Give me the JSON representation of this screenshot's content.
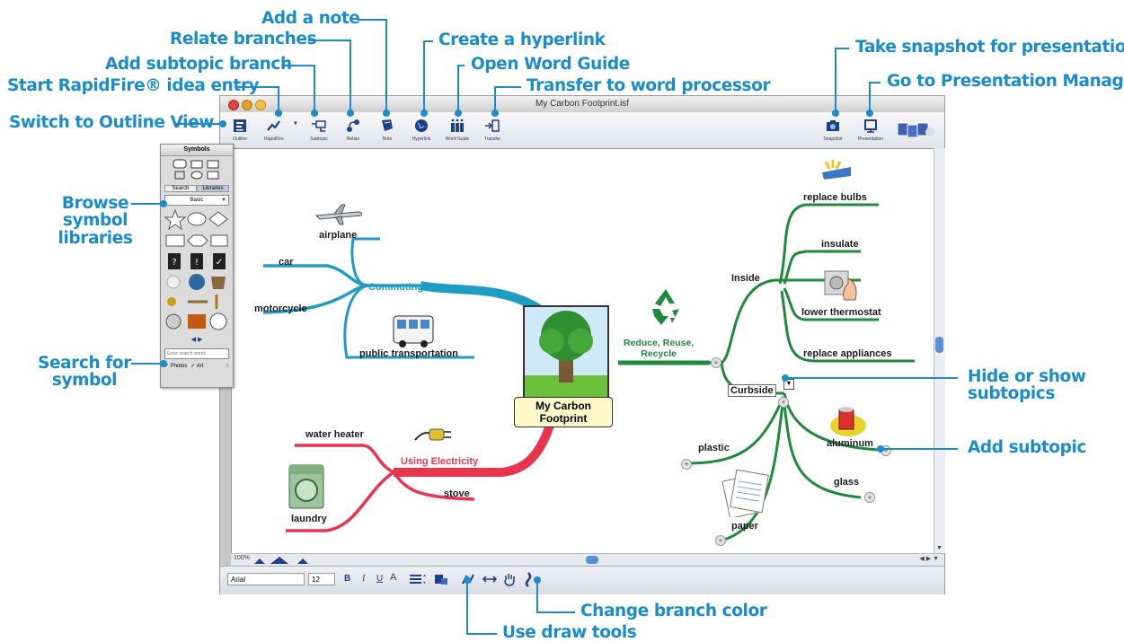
{
  "annotations": {
    "add_note": "Add a note",
    "relate_branches": "Relate branches",
    "create_hyperlink": "Create a hyperlink",
    "add_subtopic_branch": "Add subtopic branch",
    "open_word_guide": "Open Word Guide",
    "start_rapidfire": "Start RapidFire® idea entry",
    "transfer_word_processor": "Transfer to word processor",
    "switch_outline": "Switch to Outline View",
    "take_snapshot": "Take snapshot for presentation",
    "go_presentation": "Go to Presentation Manager",
    "browse_symbol": "Browse\nsymbol\nlibraries",
    "search_symbol": "Search for\nsymbol",
    "hide_show": "Hide or show\nsubtopics",
    "add_subtopic": "Add subtopic",
    "change_branch_color": "Change branch color",
    "use_draw_tools": "Use draw tools"
  },
  "window": {
    "title": "My Carbon Footprint.isf"
  },
  "toolbar": {
    "outline": "Outline",
    "rapidfire": "RapidFire",
    "subtopic": "Subtopic",
    "relate": "Relate",
    "note": "Note",
    "hyperlink": "Hyperlink",
    "word_guide": "Word Guide",
    "transfer": "Transfer",
    "snapshot": "Snapshot",
    "presentation": "Presentation"
  },
  "symbols_panel": {
    "title": "Symbols",
    "tab_search": "Search",
    "tab_libraries": "Libraries",
    "library_select": "Basic",
    "search_placeholder": "Enter search words",
    "check_photos": "Photos",
    "check_art": "Art"
  },
  "map": {
    "central": "My Carbon\nFootprint",
    "commuting": "Commuting",
    "airplane": "airplane",
    "car": "car",
    "motorcycle": "motorcycle",
    "public_transportation": "public transportation",
    "reduce": "Reduce, Reuse,\nRecycle",
    "inside": "Inside",
    "replace_bulbs": "replace bulbs",
    "insulate": "insulate",
    "lower_thermostat": "lower thermostat",
    "replace_appliances": "replace appliances",
    "curbside": "Curbside",
    "plastic": "plastic",
    "aluminum": "aluminum",
    "glass": "glass",
    "paper": "paper",
    "using_electricity": "Using Electricity",
    "water_heater": "water heater",
    "stove": "stove",
    "laundry": "laundry",
    "plus": "+"
  },
  "zoom": "100%",
  "format": {
    "font": "Arial",
    "size": "12",
    "bold": "B",
    "italic": "I",
    "underline": "U"
  },
  "colors": {
    "accent": "#1a8ccc",
    "commuting": "#1e9cc4",
    "recycle": "#1e8a3a",
    "electricity": "#e8344d"
  }
}
